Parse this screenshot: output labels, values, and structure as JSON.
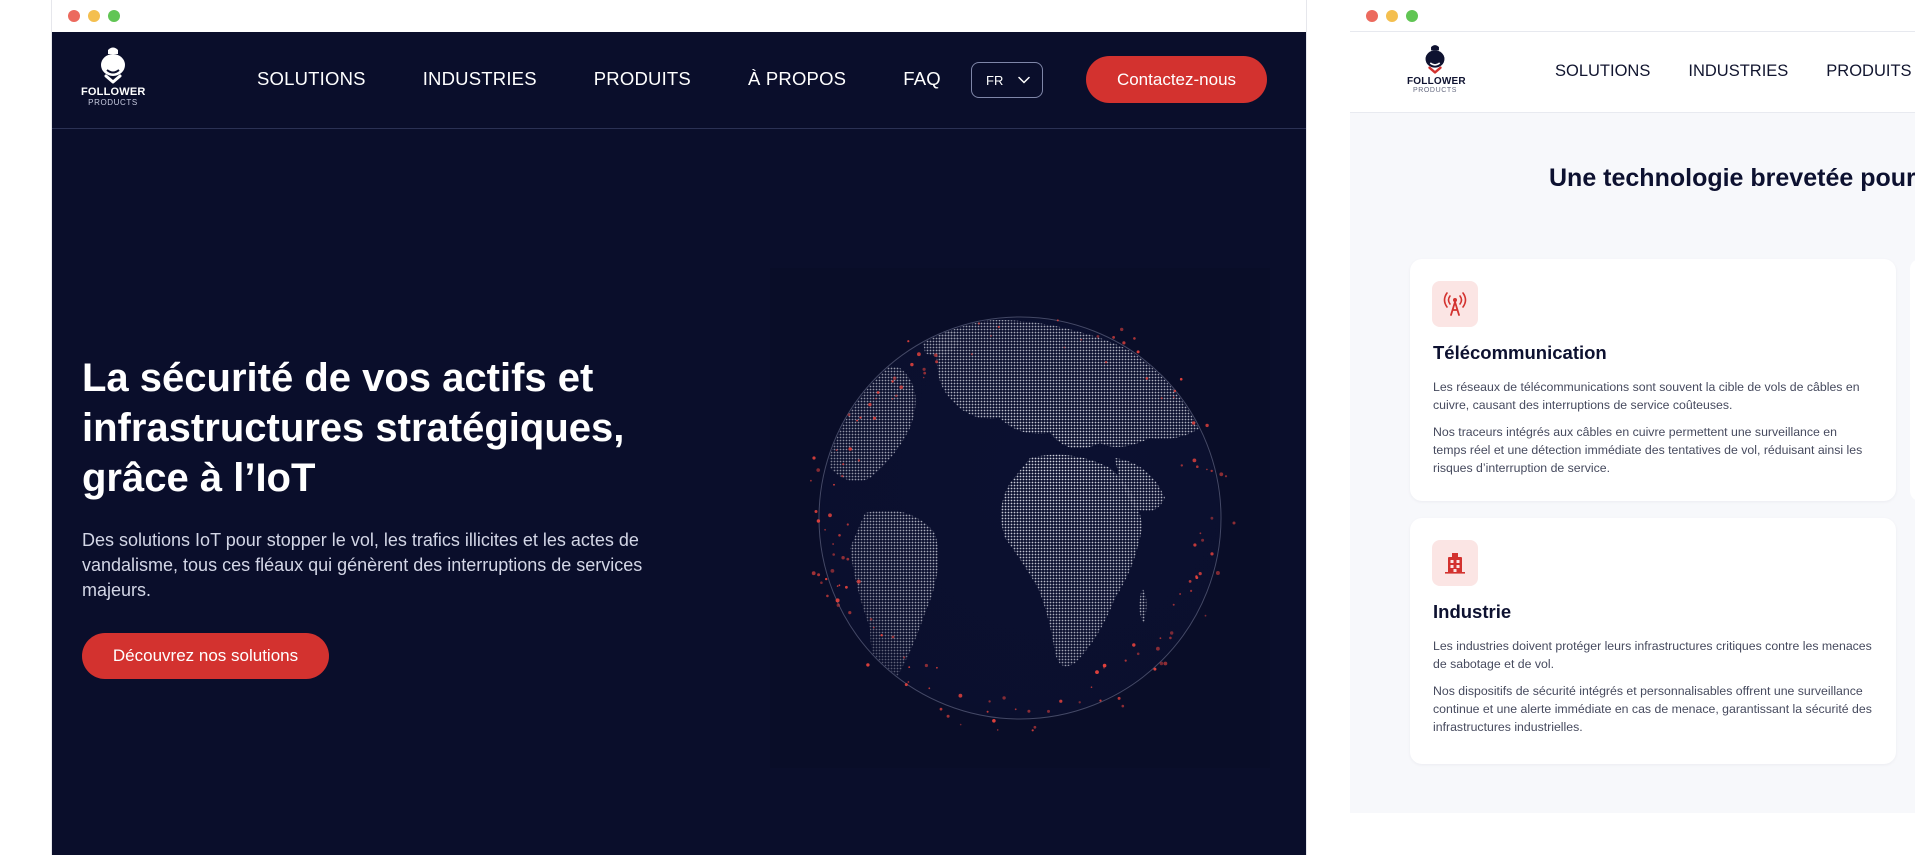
{
  "window1": {
    "logo": {
      "word": "FOLLOWER",
      "sub": "PRODUCTS"
    },
    "nav": [
      "SOLUTIONS",
      "INDUSTRIES",
      "PRODUITS",
      "À PROPOS",
      "FAQ"
    ],
    "language": "FR",
    "cta": "Contactez-nous",
    "hero": {
      "title": "La sécurité de vos actifs et infrastructures stratégiques, grâce à l’IoT",
      "subtitle": "Des solutions IoT pour stopper le vol, les trafics illicites et les actes de vandalisme, tous ces fléaux qui génèrent des interruptions de services majeurs.",
      "button": "Découvrez nos solutions",
      "image": "dotted-globe"
    },
    "colors": {
      "background": "#0a0e2b",
      "accent": "#d3322f"
    }
  },
  "window2": {
    "logo": {
      "word": "FOLLOWER",
      "sub": "PRODUCTS"
    },
    "nav": [
      "SOLUTIONS",
      "INDUSTRIES",
      "PRODUITS"
    ],
    "section_title": "Une technologie brevetée pour l",
    "cards": [
      {
        "icon": "antenna-tower-icon",
        "title": "Télécommunication",
        "p1": "Les réseaux de télécommunications sont souvent la cible de vols de câbles en cuivre, causant des interruptions de service coûteuses.",
        "p2": "Nos traceurs intégrés aux câbles en cuivre permettent une surveillance en temps réel et une détection immédiate des tentatives de vol, réduisant ainsi les risques d’interruption de service."
      },
      {
        "icon": "factory-building-icon",
        "title": "Industrie",
        "p1": "Les industries doivent protéger leurs infrastructures critiques contre les menaces de sabotage et de vol.",
        "p2": "Nos dispositifs de sécurité intégrés et personnalisables offrent une surveillance continue et une alerte immédiate en cas de menace, garantissant la sécurité des infrastructures industrielles."
      }
    ]
  }
}
